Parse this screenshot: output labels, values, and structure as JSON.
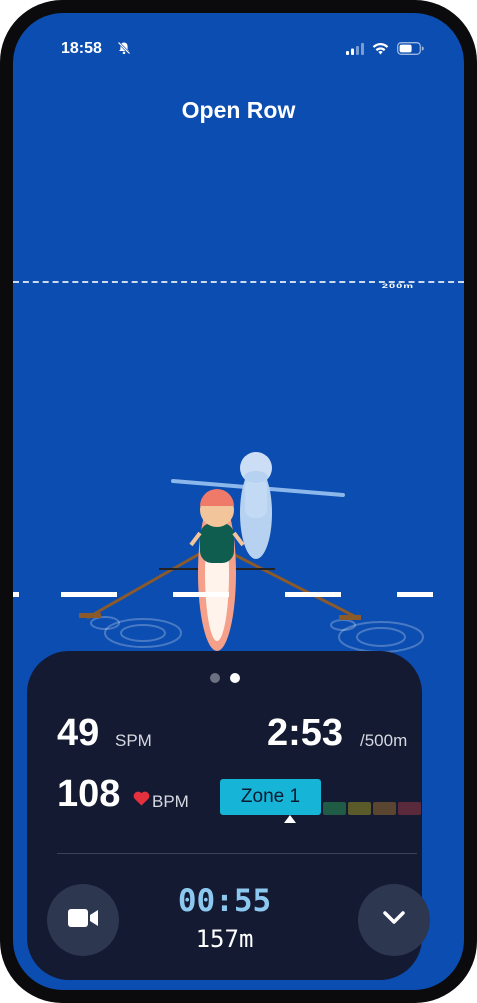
{
  "status_bar": {
    "time": "18:58"
  },
  "header": {
    "title": "Open Row"
  },
  "course": {
    "distance_marker": "200m"
  },
  "panel": {
    "page_count": 2,
    "active_page": 2,
    "stroke_rate": {
      "value": "49",
      "unit": "SPM"
    },
    "pace": {
      "value": "2:53",
      "unit": "/500m"
    },
    "heart_rate": {
      "value": "108",
      "unit": "BPM"
    },
    "zone": {
      "label": "Zone 1",
      "colors": [
        "#16b4d6",
        "#1f5b45",
        "#5a5a2a",
        "#5a4630",
        "#5a2a3c"
      ]
    },
    "elapsed_time": "00:55",
    "distance": "157m"
  },
  "colors": {
    "water": "#0b4db0",
    "panel": "#131a31",
    "accent": "#16b4d6"
  }
}
